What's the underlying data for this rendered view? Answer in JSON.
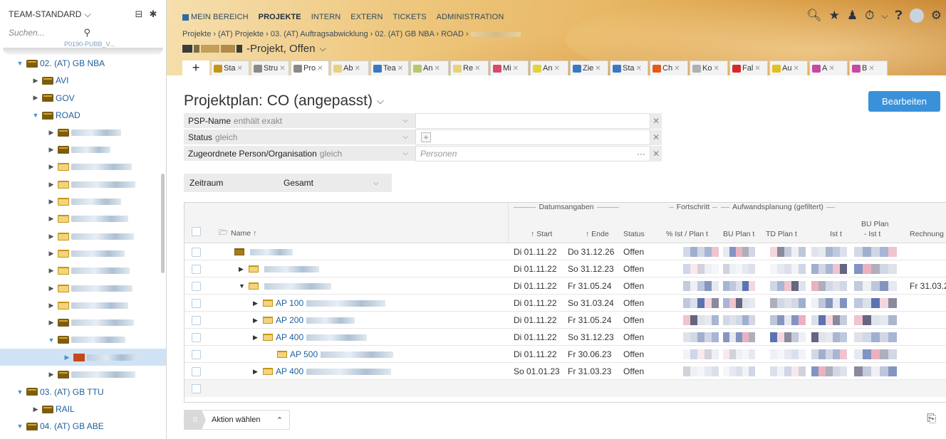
{
  "sidebar": {
    "team_label": "TEAM-STANDARD",
    "search_placeholder": "Suchen...",
    "partial_item": "P0190-PUBB_V...",
    "items": [
      {
        "label": "02. (AT) GB NBA",
        "level": 0,
        "open": true,
        "folder": "stack"
      },
      {
        "label": "AVI",
        "level": 1,
        "open": false,
        "folder": "stack"
      },
      {
        "label": "GOV",
        "level": 1,
        "open": false,
        "folder": "stack"
      },
      {
        "label": "ROAD",
        "level": 1,
        "open": true,
        "folder": "stack"
      },
      {
        "label": "",
        "level": 2,
        "open": false,
        "folder": "stack",
        "blur": 70
      },
      {
        "label": "",
        "level": 2,
        "open": false,
        "folder": "stack",
        "blur": 55
      },
      {
        "label": "",
        "level": 2,
        "open": false,
        "folder": "plain",
        "blur": 85
      },
      {
        "label": "",
        "level": 2,
        "open": false,
        "folder": "plain",
        "blur": 90
      },
      {
        "label": "",
        "level": 2,
        "open": false,
        "folder": "plain",
        "blur": 70
      },
      {
        "label": "",
        "level": 2,
        "open": false,
        "folder": "plain",
        "blur": 80
      },
      {
        "label": "",
        "level": 2,
        "open": false,
        "folder": "plain",
        "blur": 88
      },
      {
        "label": "",
        "level": 2,
        "open": false,
        "folder": "plain",
        "blur": 75
      },
      {
        "label": "",
        "level": 2,
        "open": false,
        "folder": "plain",
        "blur": 82
      },
      {
        "label": "",
        "level": 2,
        "open": false,
        "folder": "plain",
        "blur": 86
      },
      {
        "label": "",
        "level": 2,
        "open": false,
        "folder": "plain",
        "blur": 80
      },
      {
        "label": "",
        "level": 2,
        "open": false,
        "folder": "stack",
        "blur": 88
      },
      {
        "label": "",
        "level": 2,
        "open": true,
        "folder": "stack",
        "blur": 76
      },
      {
        "label": "",
        "level": 3,
        "open": false,
        "folder": "red",
        "blur": 70,
        "selected": true
      },
      {
        "label": "",
        "level": 2,
        "open": false,
        "folder": "stack",
        "blur": 90
      },
      {
        "label": "03. (AT) GB TTU",
        "level": 0,
        "open": true,
        "folder": "stack"
      },
      {
        "label": "RAIL",
        "level": 1,
        "open": false,
        "folder": "stack"
      },
      {
        "label": "04. (AT) GB ABE",
        "level": 0,
        "open": true,
        "folder": "stack"
      }
    ]
  },
  "topnav": {
    "items": [
      {
        "label": "MEIN BEREICH",
        "active": false
      },
      {
        "label": "PROJEKTE",
        "active": true
      },
      {
        "label": "INTERN",
        "active": false
      },
      {
        "label": "EXTERN",
        "active": false
      },
      {
        "label": "TICKETS",
        "active": false
      },
      {
        "label": "ADMINISTRATION",
        "active": false
      }
    ]
  },
  "breadcrumb": "Projekte › (AT) Projekte › 03. (AT) Auftragsabwicklung › 02. (AT) GB NBA › ROAD ›",
  "project_status": "-Projekt, Offen",
  "tabs": [
    {
      "label": "Sta",
      "color": "#c59516",
      "active": false
    },
    {
      "label": "Stru",
      "color": "#8a8a8a",
      "active": false
    },
    {
      "label": "Pro",
      "color": "#8a8a8a",
      "active": true
    },
    {
      "label": "Ab",
      "color": "#e8d27a",
      "active": false
    },
    {
      "label": "Tea",
      "color": "#3a78c2",
      "active": false
    },
    {
      "label": "An",
      "color": "#b6c86a",
      "active": false
    },
    {
      "label": "Re",
      "color": "#e8d27a",
      "active": false
    },
    {
      "label": "Mi",
      "color": "#d64a6a",
      "active": false
    },
    {
      "label": "An",
      "color": "#e4d23a",
      "active": false
    },
    {
      "label": "Zie",
      "color": "#3a78c2",
      "active": false
    },
    {
      "label": "Sta",
      "color": "#3a78c2",
      "active": false
    },
    {
      "label": "Ch",
      "color": "#e45a1a",
      "active": false
    },
    {
      "label": "Ko",
      "color": "#b0b0b0",
      "active": false
    },
    {
      "label": "Fal",
      "color": "#d62a2a",
      "active": false
    },
    {
      "label": "Au",
      "color": "#e4c01a",
      "active": false
    },
    {
      "label": "A",
      "color": "#c84aa0",
      "active": false
    },
    {
      "label": "B",
      "color": "#c84aa0",
      "active": false
    }
  ],
  "page": {
    "title": "Projektplan: CO (angepasst)",
    "edit_button": "Bearbeiten"
  },
  "filters": [
    {
      "label": "PSP-Name",
      "operator": "enthält exakt",
      "value_placeholder": ""
    },
    {
      "label": "Status",
      "operator": "gleich",
      "value_placeholder": ""
    },
    {
      "label": "Zugeordnete Person/Organisation",
      "operator": "gleich",
      "value_placeholder": "Personen"
    }
  ],
  "zeitraum": {
    "label": "Zeitraum",
    "value": "Gesamt"
  },
  "grid": {
    "group_headers": {
      "datum": "Datumsangaben",
      "fortschritt": "Fortschritt",
      "aufwand": "Aufwandsplanung (gefiltert)"
    },
    "columns": {
      "name": "Name ↑",
      "start": "↑ Start",
      "ende": "↑ Ende",
      "status": "Status",
      "pct": "% Ist / Plan t",
      "bu_plan": "BU Plan t",
      "td_plan": "TD Plan t",
      "ist": "Ist t",
      "bu_plan_ist_1": "BU Plan",
      "bu_plan_ist_2": "- Ist t",
      "rechnung": "Rechnung"
    },
    "rows": [
      {
        "name": "",
        "indent": 0,
        "expander": "",
        "folder": "dark",
        "start": "Di 01.11.22",
        "ende": "Do 31.12.26",
        "status": "Offen",
        "rechnung": ""
      },
      {
        "name": "",
        "indent": 1,
        "expander": "▶",
        "folder": "plain",
        "start": "Di 01.11.22",
        "ende": "So 31.12.23",
        "status": "Offen",
        "rechnung": ""
      },
      {
        "name": "",
        "indent": 1,
        "expander": "▼",
        "folder": "plain",
        "start": "Di 01.11.22",
        "ende": "Fr 31.05.24",
        "status": "Offen",
        "rechnung": "Fr 31.03.2"
      },
      {
        "name": "AP 100",
        "indent": 2,
        "expander": "▶",
        "folder": "plain",
        "start": "Di 01.11.22",
        "ende": "So 31.03.24",
        "status": "Offen",
        "rechnung": ""
      },
      {
        "name": "AP 200",
        "indent": 2,
        "expander": "▶",
        "folder": "plain",
        "start": "Di 01.11.22",
        "ende": "Fr 31.05.24",
        "status": "Offen",
        "rechnung": ""
      },
      {
        "name": "AP 400",
        "indent": 2,
        "expander": "▶",
        "folder": "plain",
        "start": "Di 01.11.22",
        "ende": "So 31.12.23",
        "status": "Offen",
        "rechnung": ""
      },
      {
        "name": "AP 500",
        "indent": 3,
        "expander": "",
        "folder": "plain",
        "start": "Di 01.11.22",
        "ende": "Fr 30.06.23",
        "status": "Offen",
        "rechnung": ""
      },
      {
        "name": "AP 400",
        "indent": 2,
        "expander": "▶",
        "folder": "plain",
        "start": "So 01.01.23",
        "ende": "Fr 31.03.23",
        "status": "Offen",
        "rechnung": ""
      }
    ]
  },
  "action_bar": {
    "count": "0",
    "label": "Aktion wählen"
  },
  "colors": {
    "accent": "#3a91d9",
    "link": "#1f5f9c",
    "selected_row": "#cfe3f4"
  }
}
